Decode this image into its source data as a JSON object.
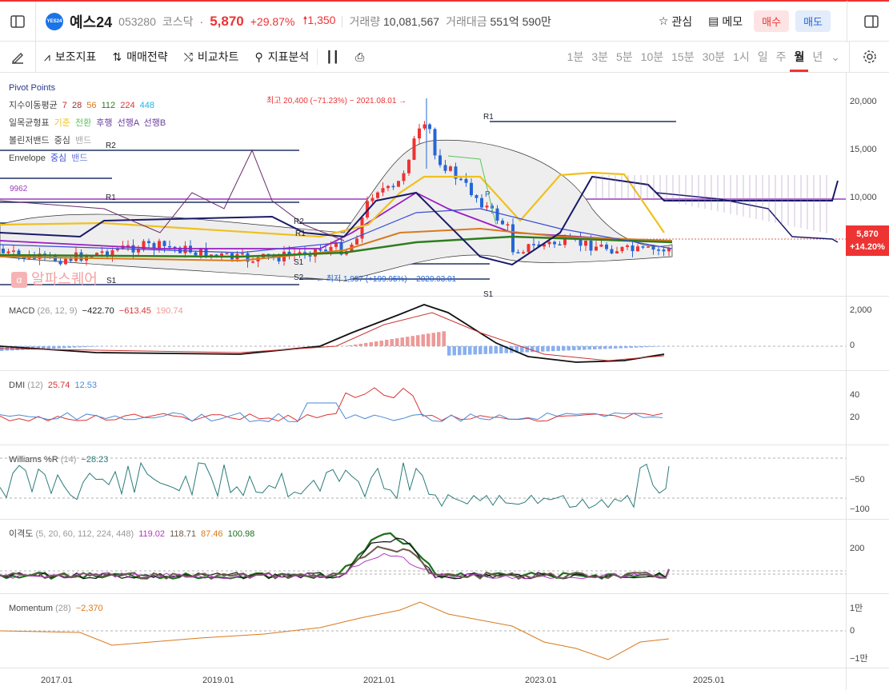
{
  "header": {
    "logo_text": "YES24",
    "name": "예스24",
    "code": "053280",
    "market": "코스닥",
    "price": "5,870",
    "change_pct": "+29.87%",
    "change": "1,350",
    "volume_label": "거래량",
    "volume": "10,081,567",
    "amount_label": "거래대금",
    "amount": "551억 590만",
    "watch_label": "관심",
    "memo_label": "메모",
    "buy_label": "매수",
    "sell_label": "매도"
  },
  "toolbar": {
    "aux_label": "보조지표",
    "strategy_label": "매매전략",
    "compare_label": "비교차트",
    "analysis_label": "지표분석",
    "periods": [
      "1분",
      "3분",
      "5분",
      "10분",
      "15분",
      "30분",
      "1시",
      "일",
      "주",
      "월",
      "년"
    ],
    "active_period": "월"
  },
  "main_legend": {
    "pivot": "Pivot Points",
    "ma_label": "지수이동평균",
    "ma_values": [
      "7",
      "28",
      "56",
      "112",
      "224",
      "448"
    ],
    "ichimoku_label": "일목균형표",
    "ichimoku_items": [
      "기준",
      "전환",
      "후행",
      "선행A",
      "선행B"
    ],
    "bollinger_label": "볼린저밴드",
    "bollinger_items": [
      "중심",
      "밴드"
    ],
    "envelope_label": "Envelope",
    "envelope_items": [
      "중심",
      "밴드"
    ],
    "hline_value": "9962",
    "watermark": "알파스퀘어",
    "high_annotation": "최고 20,400 (−71.23%) − 2021.08.01 →",
    "low_annotation": "← 최저 1,957 (+199.95%) − 2020.03.01",
    "pivot_labels": [
      "R2",
      "R1",
      "R2",
      "R1",
      "S1",
      "S2",
      "S1",
      "R1",
      "S1",
      "P"
    ],
    "price_tag": "5,870",
    "price_tag_pct": "+14.20%",
    "yaxis": [
      "20,000",
      "15,000",
      "10,000"
    ]
  },
  "indicators": {
    "macd": {
      "name": "MACD",
      "params": "(26, 12, 9)",
      "v1": "−422.70",
      "v2": "−613.45",
      "v3": "190.74",
      "yaxis": [
        "2,000",
        "0"
      ]
    },
    "dmi": {
      "name": "DMI",
      "params": "(12)",
      "v1": "25.74",
      "v2": "12.53",
      "yaxis": [
        "40",
        "20"
      ]
    },
    "williams": {
      "name": "Williams %R",
      "params": "(14)",
      "v1": "−28.23",
      "yaxis": [
        "−50",
        "−100"
      ]
    },
    "disparity": {
      "name": "이격도",
      "params": "(5, 20, 60, 112, 224, 448)",
      "v1": "119.02",
      "v2": "118.71",
      "v3": "87.46",
      "v4": "100.98",
      "yaxis": [
        "200"
      ]
    },
    "momentum": {
      "name": "Momentum",
      "params": "(28)",
      "v1": "−2,370",
      "yaxis": [
        "1만",
        "0",
        "−1만"
      ]
    }
  },
  "xaxis": [
    "2017.01",
    "2019.01",
    "2021.01",
    "2023.01",
    "2025.01"
  ],
  "colors": {
    "up": "#e33",
    "down": "#2666d6",
    "accent": "#e33",
    "ma7": "#d4282f",
    "ma28": "#9b3131",
    "ma56": "#d87a1e",
    "ma112": "#2e7d1e",
    "ma224": "#e33535",
    "ma448": "#1fb4e6"
  }
}
